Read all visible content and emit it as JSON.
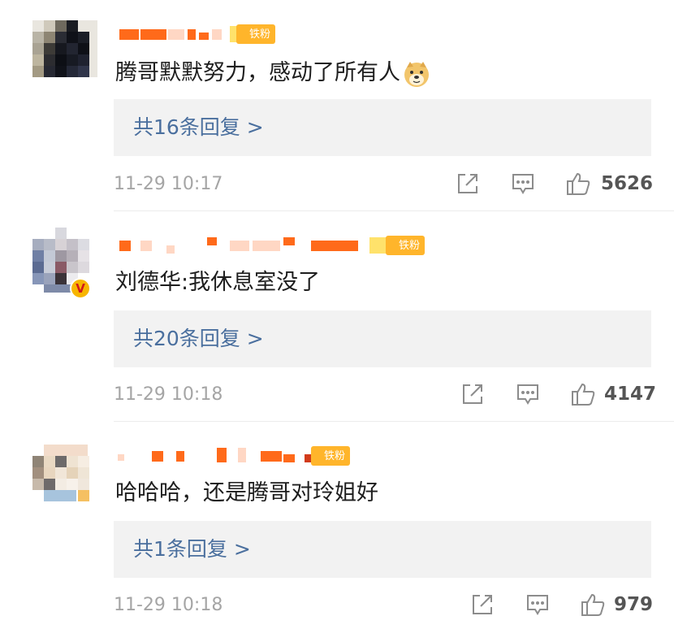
{
  "comments": [
    {
      "fan_badge": "铁粉",
      "text": "腾哥默默努力，感动了所有人",
      "emoji": "doge-emoji",
      "reply_label": "共16条回复 >",
      "time": "11-29 10:17",
      "likes": "5626"
    },
    {
      "fan_badge": "铁粉",
      "verified": true,
      "text": "刘德华:我休息室没了",
      "reply_label": "共20条回复 >",
      "time": "11-29 10:18",
      "likes": "4147"
    },
    {
      "fan_badge": "铁粉",
      "text": "哈哈哈，还是腾哥对玲姐好",
      "reply_label": "共1条回复 >",
      "time": "11-29 10:18",
      "likes": "979"
    }
  ],
  "icons": {
    "share": "share-icon",
    "comment": "comment-icon",
    "like": "thumbs-up-icon"
  },
  "colors": {
    "link": "#4a6f9e",
    "badge": "#ffb52b",
    "time": "#a5a5a5",
    "reply_bg": "#f2f2f2"
  }
}
